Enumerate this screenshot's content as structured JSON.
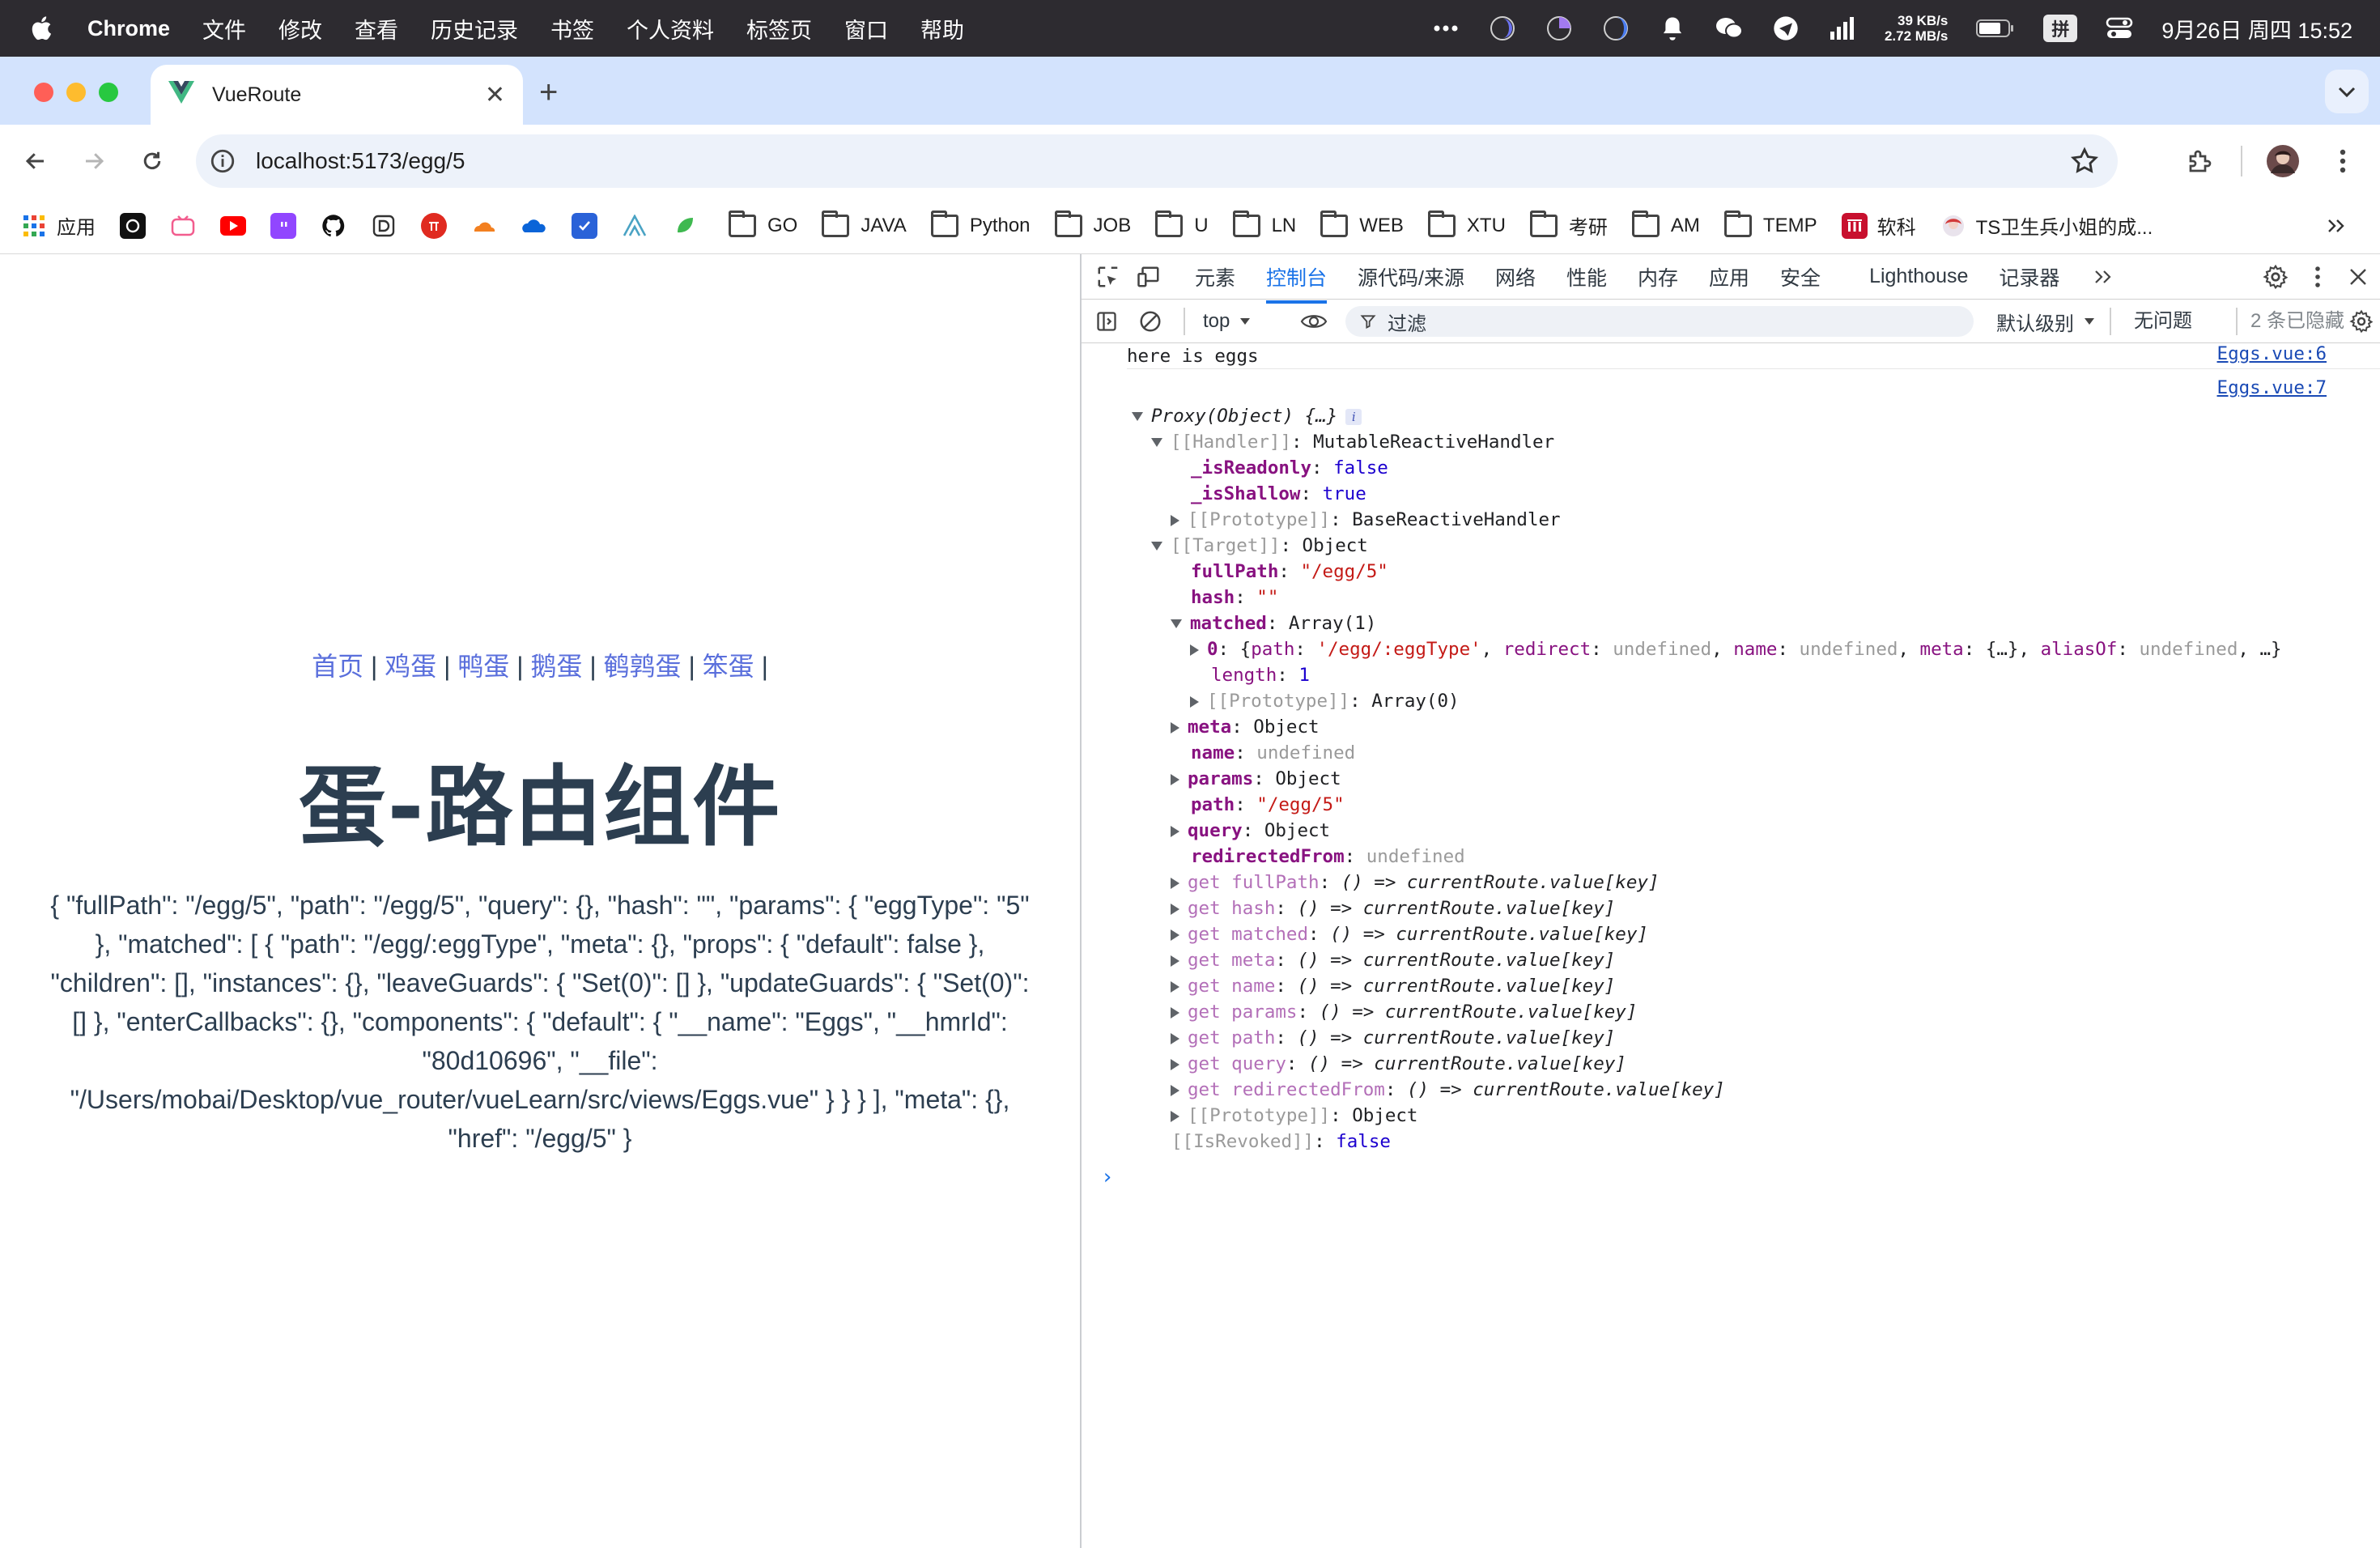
{
  "menubar": {
    "app_name": "Chrome",
    "items": [
      "文件",
      "修改",
      "查看",
      "历史记录",
      "书签",
      "个人资料",
      "标签页",
      "窗口",
      "帮助"
    ],
    "net_up": "39 KB/s",
    "net_down": "2.72 MB/s",
    "ime": "拼",
    "clock": "9月26日 周四  15:52"
  },
  "tab": {
    "title": "VueRoute",
    "new_tab": "+"
  },
  "omnibox": {
    "url": "localhost:5173/egg/5"
  },
  "bookmarks": {
    "apps_label": "应用",
    "folders": [
      "GO",
      "JAVA",
      "Python",
      "JOB",
      "U",
      "LN",
      "WEB",
      "XTU",
      "考研",
      "AM",
      "TEMP"
    ],
    "ruanke": "软科",
    "ts": "TS卫生兵小姐的成..."
  },
  "page": {
    "nav": [
      "首页",
      "鸡蛋",
      "鸭蛋",
      "鹅蛋",
      "鹌鹑蛋",
      "笨蛋"
    ],
    "nav_sep": "|",
    "heading": "蛋-路由组件",
    "route_json": "{ \"fullPath\": \"/egg/5\", \"path\": \"/egg/5\", \"query\": {}, \"hash\": \"\", \"params\": { \"eggType\": \"5\" }, \"matched\": [ { \"path\": \"/egg/:eggType\", \"meta\": {}, \"props\": { \"default\": false }, \"children\": [], \"instances\": {}, \"leaveGuards\": { \"Set(0)\": [] }, \"updateGuards\": { \"Set(0)\": [] }, \"enterCallbacks\": {}, \"components\": { \"default\": { \"__name\": \"Eggs\", \"__hmrId\": \"80d10696\", \"__file\": \"/Users/mobai/Desktop/vue_router/vueLearn/src/views/Eggs.vue\" } } } ], \"meta\": {}, \"href\": \"/egg/5\" }"
  },
  "devtools": {
    "tabs": [
      "元素",
      "控制台",
      "源代码/来源",
      "网络",
      "性能",
      "内存",
      "应用",
      "安全",
      "Lighthouse",
      "记录器"
    ],
    "active_tab": "控制台",
    "context": "top",
    "filter_placeholder": "过滤",
    "level": "默认级别",
    "issues": "无问题",
    "hidden": "2 条已隐藏",
    "log1_text": "here is eggs",
    "log1_src": "Eggs.vue:6",
    "log2_src": "Eggs.vue:7",
    "accent": "#1a73e8"
  },
  "colors": {
    "menubar_bg": "#2d2b30",
    "tabstrip_bg": "#d3e3fd",
    "omnibox_bg": "#edf2fa",
    "link": "#5a6fdc",
    "heading": "#2c3e50"
  }
}
